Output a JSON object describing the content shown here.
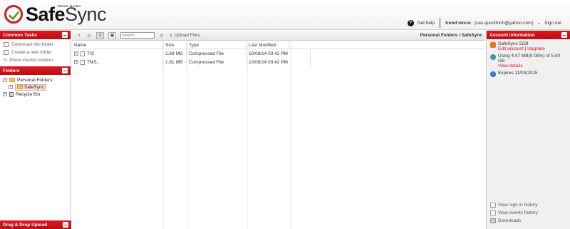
{
  "brand": {
    "name_bold": "Safe",
    "name_light": "Sync",
    "sub": "TREND MICRO"
  },
  "topbar": {
    "help_label": "Get help",
    "user_name": "trend micro",
    "user_email": "(cas.quocthinh@yahoo.com)",
    "signout_label": "Sign out"
  },
  "left": {
    "common_tasks_title": "Common Tasks",
    "tasks": [
      {
        "label": "Download this folder",
        "icon": "download-icon"
      },
      {
        "label": "Create a new folder",
        "icon": "new-folder-icon"
      },
      {
        "label": "Show shared content",
        "icon": "share-icon"
      }
    ],
    "folders_title": "Folders",
    "tree": {
      "root_label": "Personal Folders",
      "selected_label": "SafeSync",
      "bin_label": "Recycle Bin"
    },
    "dragdrop_title": "Drag & Drop Upload"
  },
  "toolbar": {
    "search_placeholder": "search...",
    "upload_label": "Upload Files",
    "breadcrumb": "Personal Folders / SafeSync"
  },
  "table": {
    "headers": [
      "Name",
      "Size",
      "Type",
      "Last Modified"
    ],
    "rows": [
      {
        "name": "TIS",
        "size": "1.69 MB",
        "type": "Compressed File",
        "modified": "10/08/14 03:42 PM"
      },
      {
        "name": "TMS...",
        "size": "1.81 MB",
        "type": "Compressed File",
        "modified": "10/08/14 03:42 PM"
      }
    ]
  },
  "right": {
    "title": "Account information",
    "plan": "SafeSync 5GB",
    "edit_account": "Edit account",
    "upgrade": "Upgrade",
    "usage": "Using 4.07 MB(0.08%) of 5.00 GB",
    "view_details": "View details",
    "expires": "Expires 11/03/2015",
    "links": [
      "View sign in history",
      "View events history",
      "Downloads"
    ]
  },
  "colors": {
    "accent_red": "#d71920",
    "check_green": "#6aa22c"
  }
}
